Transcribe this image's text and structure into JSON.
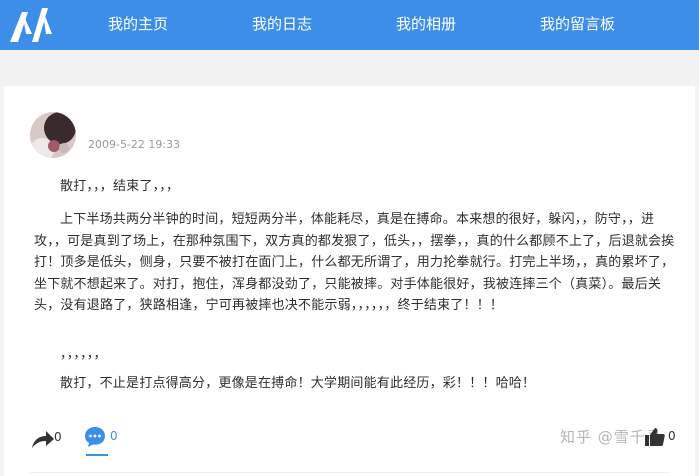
{
  "nav": {
    "items": [
      "我的主页",
      "我的日志",
      "我的相册",
      "我的留言板"
    ]
  },
  "post": {
    "timestamp": "2009-5-22 19:33",
    "paragraphs": [
      "散打，，，结束了，，，",
      "上下半场共两分半钟的时间，短短两分半，体能耗尽，真是在搏命。本来想的很好，躲闪，，防守，，进攻，，可是真到了场上，在那种氛围下，双方真的都发狠了，低头，，摆拳，，真的什么都顾不上了，后退就会挨打！顶多是低头，侧身，只要不被打在面门上，什么都无所谓了，用力抡拳就行。打完上半场，，真的累坏了，坐下就不想起来了。对打，抱住，浑身都没劲了，只能被摔。对手体能很好，我被连摔三个（真菜）。最后关头，没有退路了，狭路相逢，宁可再被摔也决不能示弱，，，，，，终于结束了！！！",
      "，，，，，，",
      "散打，不止是打点得高分，更像是在搏命！大学期间能有此经历，彩！！！哈哈！"
    ]
  },
  "actions": {
    "share_count": "0",
    "comment_count": "0",
    "like_count": "0"
  },
  "watermark": "知乎 @雪千寻",
  "colors": {
    "nav_bg": "#3d8ee8",
    "accent": "#3d8ee8"
  }
}
